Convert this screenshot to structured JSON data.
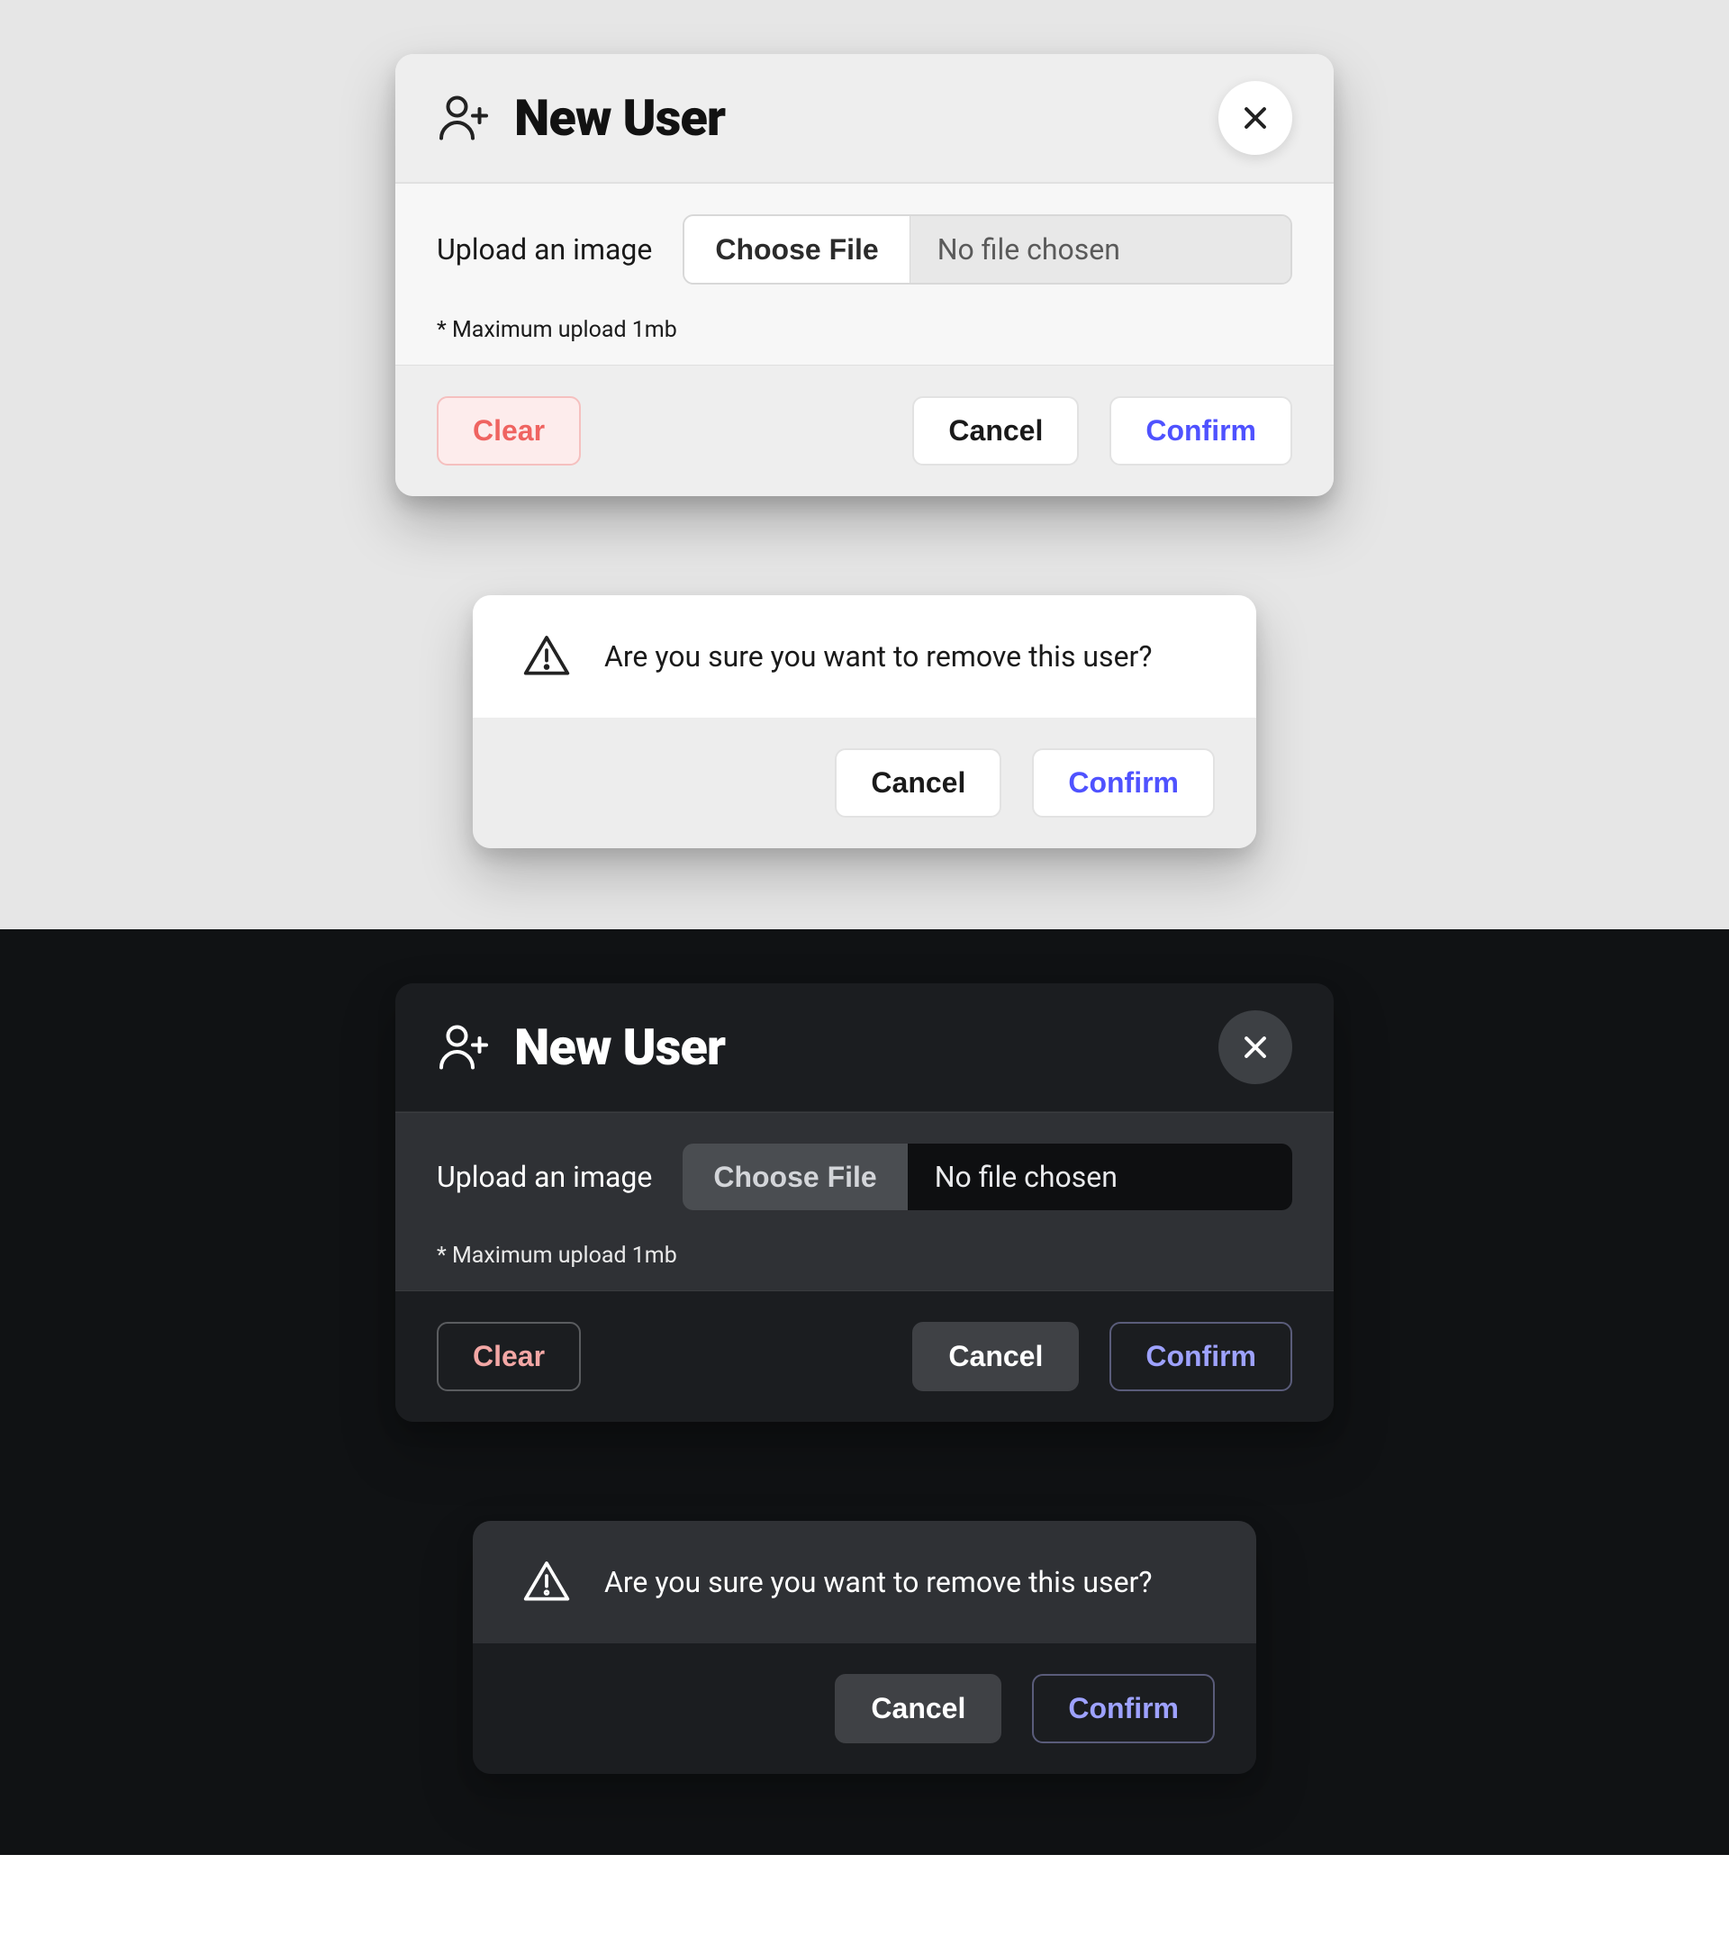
{
  "newUser": {
    "title": "New User",
    "uploadLabel": "Upload an image",
    "chooseFile": "Choose File",
    "noFile": "No file chosen",
    "hint": "* Maximum upload 1mb",
    "clear": "Clear",
    "cancel": "Cancel",
    "confirm": "Confirm"
  },
  "removeUser": {
    "message": "Are you sure you want to remove this user?",
    "cancel": "Cancel",
    "confirm": "Confirm"
  },
  "colors": {
    "lightBg": "#e6e6e6",
    "darkBg": "#101214",
    "accent": "#4f52ff",
    "danger": "#ef6461"
  }
}
